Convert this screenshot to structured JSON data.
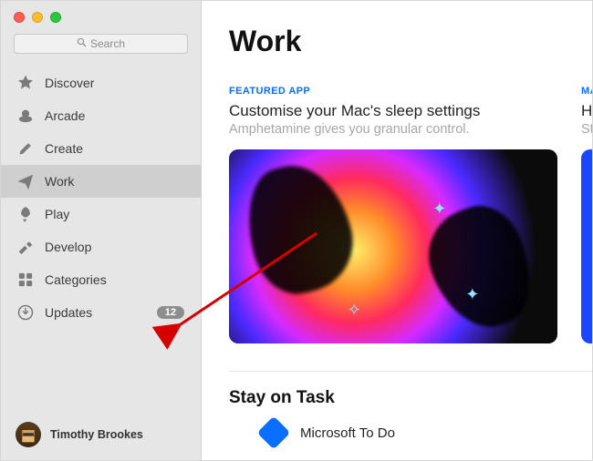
{
  "window": {
    "search_placeholder": "Search"
  },
  "sidebar": {
    "items": [
      {
        "label": "Discover"
      },
      {
        "label": "Arcade"
      },
      {
        "label": "Create"
      },
      {
        "label": "Work"
      },
      {
        "label": "Play"
      },
      {
        "label": "Develop"
      },
      {
        "label": "Categories"
      },
      {
        "label": "Updates",
        "badge": "12"
      }
    ]
  },
  "user": {
    "name": "Timothy Brookes"
  },
  "main": {
    "title": "Work",
    "featured": {
      "eyebrow": "FEATURED APP",
      "headline": "Customise your Mac's sleep settings",
      "sub": "Amphetamine gives you granular control."
    },
    "card2": {
      "eyebrow": "MASTER YO",
      "headline": "Help Ma",
      "sub": "Streamli"
    },
    "section2": {
      "title": "Stay on Task",
      "app_name": "Microsoft To Do"
    }
  }
}
